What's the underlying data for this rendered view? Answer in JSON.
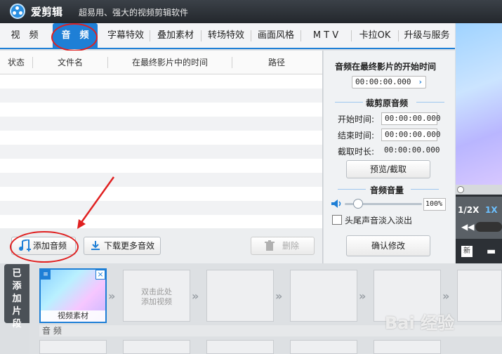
{
  "app": {
    "name": "爱剪辑",
    "slogan": "超易用、强大的视频剪辑软件"
  },
  "tabs": [
    "视　频",
    "音　频",
    "字幕特效",
    "叠加素材",
    "转场特效",
    "画面风格",
    "M T V",
    "卡拉OK",
    "升级与服务"
  ],
  "active_tab": "音　频",
  "table": {
    "headers": [
      "状态",
      "文件名",
      "在最终影片中的时间",
      "路径"
    ]
  },
  "buttons": {
    "add_audio": "添加音频",
    "download_effects": "下载更多音效",
    "delete": "删除",
    "confirm": "确认修改",
    "preview_cut": "预览/截取"
  },
  "props": {
    "start_in_final_title": "音频在最终影片的开始时间",
    "start_in_final_value": "00:00:00.000",
    "cut_section": "裁剪原音频",
    "start_label": "开始时间:",
    "start_value": "00:00:00.000",
    "end_label": "结束时间:",
    "end_value": "00:00:00.000",
    "duration_label": "截取时长:",
    "duration_value": "00:00:00.000",
    "volume_section": "音频音量",
    "volume_percent": "100%",
    "fade_label": "头尾声音淡入淡出"
  },
  "preview": {
    "speed_half": "1/2X",
    "speed_one": "1X",
    "new_label": "新"
  },
  "sidebar_tab": "已添加片段",
  "timeline": {
    "clip1_label": "视频素材",
    "placeholder": "双击此处\n添加视频",
    "audio_label": "音 频"
  },
  "watermark": "Bai 经验"
}
